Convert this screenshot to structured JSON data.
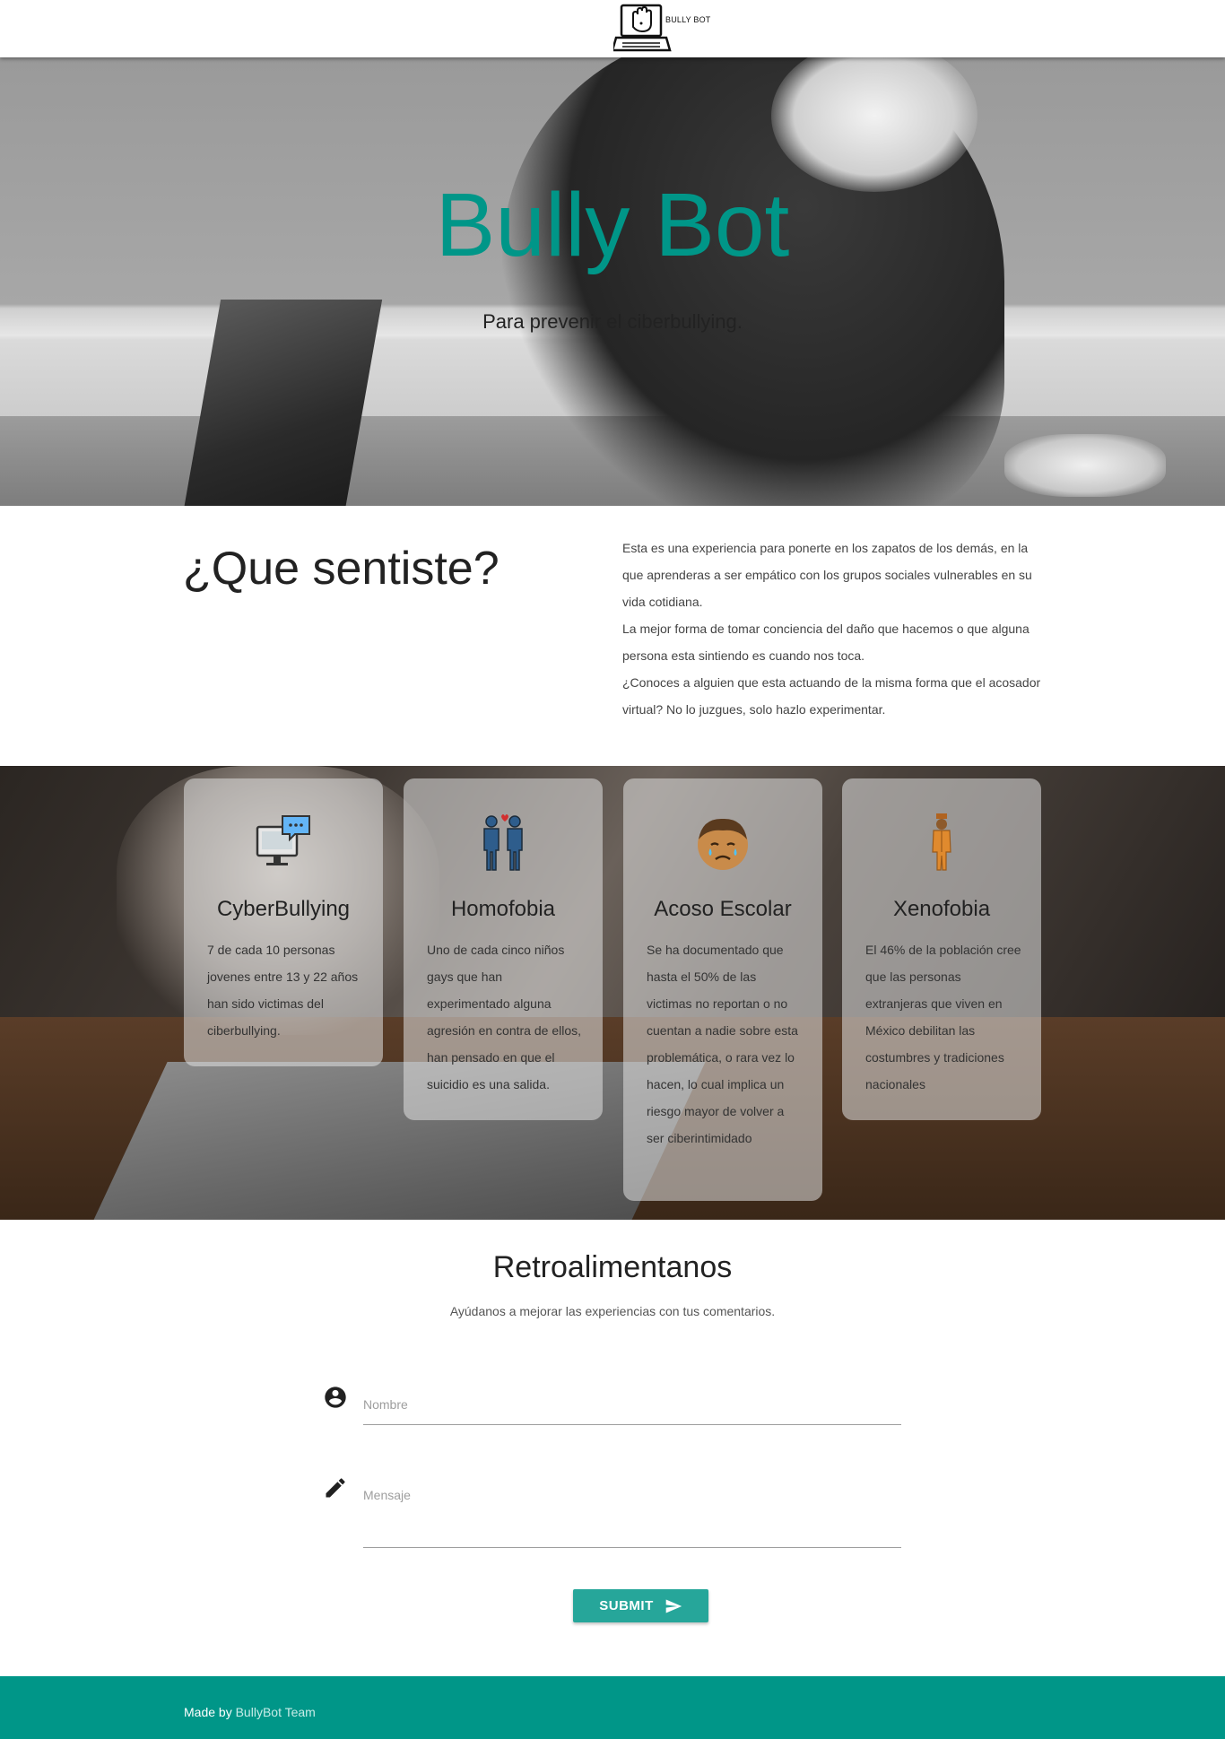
{
  "nav": {
    "logo_text": "BULLY BOT",
    "logo_icon": "laptop-hand-icon"
  },
  "hero": {
    "title": "Bully Bot",
    "subtitle": "Para prevenir el ciberbullying."
  },
  "about": {
    "heading": "¿Que sentiste?",
    "paragraphs": [
      "Esta es una experiencia para ponerte en los zapatos de los demás, en la que aprenderas a ser empático con los grupos sociales vulnerables en su vida cotidiana.",
      "La mejor forma de tomar conciencia del daño que hacemos o que alguna persona esta sintiendo es cuando nos toca.",
      "¿Conoces a alguien que esta actuando de la misma forma que el acosador virtual? No lo juzgues, solo hazlo experimentar."
    ]
  },
  "cards": [
    {
      "icon": "computer-chat-icon",
      "title": "CyberBullying",
      "body": "7 de cada 10 personas jovenes entre 13 y 22 años han sido victimas del ciberbullying."
    },
    {
      "icon": "couple-men-icon",
      "title": "Homofobia",
      "body": "Uno de cada cinco niños gays que han experimentado alguna agresión en contra de ellos, han pensado en que el suicidio es una salida."
    },
    {
      "icon": "crying-boy-icon",
      "title": "Acoso Escolar",
      "body": "Se ha documentado que hasta el 50% de las victimas no reportan o no cuentan a nadie sobre esta problemática, o rara vez lo hacen, lo cual implica un riesgo mayor de volver a ser ciberintimidado"
    },
    {
      "icon": "foreign-man-icon",
      "title": "Xenofobia",
      "body": "El 46% de la población cree que las personas extranjeras que viven en México debilitan las costumbres y tradiciones nacionales"
    }
  ],
  "feedback": {
    "title": "Retroalimentanos",
    "subtitle": "Ayúdanos a mejorar las experiencias con tus comentarios.",
    "name_label": "Nombre",
    "message_label": "Mensaje",
    "submit_label": "SUBMIT",
    "name_icon": "account-circle-icon",
    "message_icon": "pencil-icon",
    "submit_icon": "send-icon"
  },
  "footer": {
    "prefix": "Made by ",
    "link_text": "BullyBot Team"
  },
  "colors": {
    "accent": "#009688",
    "button": "#26a69a",
    "footer": "#009688"
  }
}
